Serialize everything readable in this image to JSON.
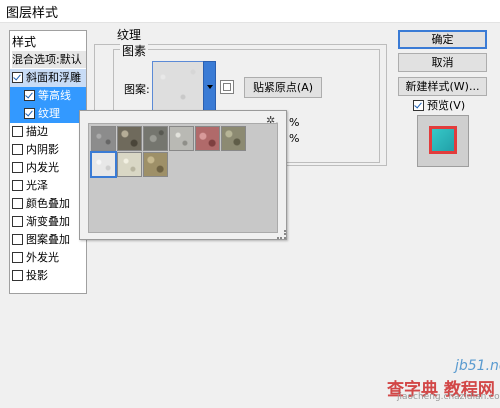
{
  "window": {
    "title": "图层样式"
  },
  "styles_panel": {
    "header": "样式",
    "blend_options": "混合选项:默认",
    "items": [
      {
        "label": "斜面和浮雕",
        "checked": true
      },
      {
        "label": "等高线",
        "checked": true
      },
      {
        "label": "纹理",
        "checked": true
      },
      {
        "label": "描边",
        "checked": false
      },
      {
        "label": "内阴影",
        "checked": false
      },
      {
        "label": "内发光",
        "checked": false
      },
      {
        "label": "光泽",
        "checked": false
      },
      {
        "label": "颜色叠加",
        "checked": false
      },
      {
        "label": "渐变叠加",
        "checked": false
      },
      {
        "label": "图案叠加",
        "checked": false
      },
      {
        "label": "外发光",
        "checked": false
      },
      {
        "label": "投影",
        "checked": false
      }
    ]
  },
  "texture": {
    "group_title": "纹理",
    "sub_group_title": "图素",
    "pattern_label": "图案:",
    "snap_origin_button": "贴紧原点(A)",
    "percent_symbol_1": "%",
    "percent_symbol_2": "%"
  },
  "picker": {
    "gear_label": "✲.",
    "swatches": [
      {
        "name": "pattern-1",
        "color": "#8c8c8c"
      },
      {
        "name": "pattern-2",
        "color": "#6f6a5c"
      },
      {
        "name": "pattern-3",
        "color": "#75766f"
      },
      {
        "name": "pattern-4",
        "color": "#b9b9b4"
      },
      {
        "name": "pattern-5",
        "color": "#b06a6a"
      },
      {
        "name": "pattern-6",
        "color": "#8c8a72"
      },
      {
        "name": "pattern-7",
        "color": "#e8e8e8"
      },
      {
        "name": "pattern-8",
        "color": "#d9d7c5"
      },
      {
        "name": "pattern-9",
        "color": "#9e9068"
      }
    ]
  },
  "buttons": {
    "ok": "确定",
    "cancel": "取消",
    "new_style": "新建样式(W)...",
    "preview": "预览(V)"
  },
  "watermark": {
    "line1": "jb51.net",
    "line2": "查字典 教程网",
    "line3": "jiaocheng.chazidian.com"
  },
  "colors": {
    "accent": "#3399ff",
    "preview_fill": "#36c8c8",
    "preview_stroke": "#e23c3c"
  }
}
